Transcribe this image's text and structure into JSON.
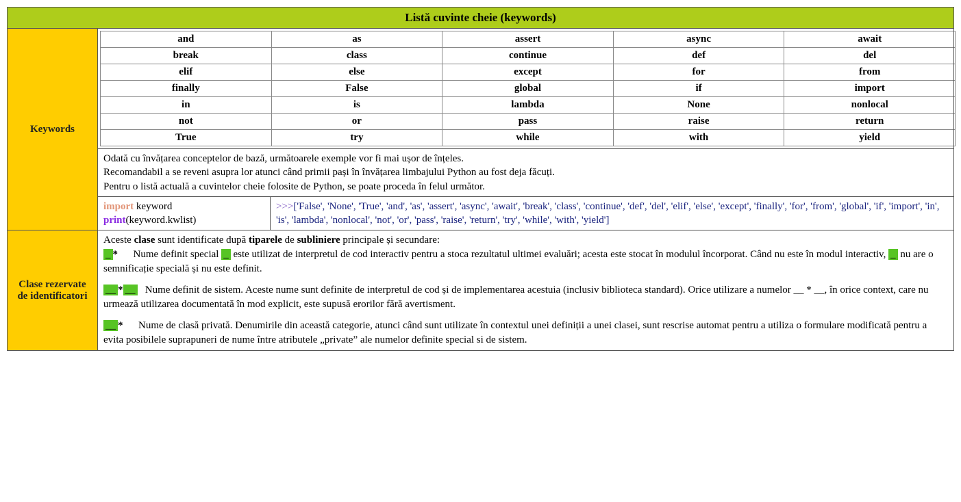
{
  "title": "Listă cuvinte cheie (keywords)",
  "labels": {
    "keywords": "Keywords",
    "reserved": "Clase rezervate de identificatori"
  },
  "keywords_grid": [
    [
      "and",
      "as",
      "assert",
      "async",
      "await"
    ],
    [
      "break",
      "class",
      "continue",
      "def",
      "del"
    ],
    [
      "elif",
      "else",
      "except",
      "for",
      "from"
    ],
    [
      "finally",
      "False",
      "global",
      "if",
      "import"
    ],
    [
      "in",
      "is",
      "lambda",
      "None",
      "nonlocal"
    ],
    [
      "not",
      "or",
      "pass",
      "raise",
      "return"
    ],
    [
      "True",
      "try",
      "while",
      "with",
      "yield"
    ]
  ],
  "description": {
    "line1": "Odată cu învățarea conceptelor de bază, următoarele exemple vor fi mai ușor de înțeles.",
    "line2": "Recomandabil a se reveni asupra lor atunci când primii pași în învățarea limbajului Python au fost deja făcuți.",
    "line3": "Pentru o listă actuală a cuvintelor cheie folosite de Python, se poate proceda în felul următor."
  },
  "code": {
    "import_kw": "import",
    "import_mod": " keyword",
    "print_kw": "print",
    "print_arg": "(keyword.kwlist)"
  },
  "output": {
    "prompt": ">>>",
    "body": "['False', 'None', 'True', 'and', 'as', 'assert', 'async', 'await', 'break', 'class', 'continue', 'def', 'del', 'elif', 'else', 'except', 'finally', 'for', 'from', 'global', 'if', 'import', 'in', 'is', 'lambda', 'nonlocal', 'not', 'or', 'pass', 'raise', 'return', 'try', 'while', 'with', 'yield']"
  },
  "ident": {
    "intro_pre": "Aceste ",
    "intro_b1": "clase",
    "intro_mid1": " sunt identificate după ",
    "intro_b2": "tiparele",
    "intro_mid2": " de ",
    "intro_b3": "subliniere",
    "intro_post": " principale și secundare:",
    "p1_underscore": "_",
    "p1_star": "*",
    "p1_pre": "      Nume definit special ",
    "p1_u2": "_",
    "p1_mid": " este utilizat de interpretul de cod interactiv pentru a stoca rezultatul ultimei evaluări; acesta este stocat în modulul încorporat. Când nu este în modul interactiv, ",
    "p1_u3": "_",
    "p1_post": " nu are o semnificație specială și nu este definit.",
    "p2_underscore": "__",
    "p2_star": "*",
    "p2_underscore2": "__",
    "p2_body": "   Nume definit de sistem. Aceste nume sunt definite de interpretul de cod și de implementarea acestuia (inclusiv biblioteca standard). Orice utilizare a numelor __ * __, în orice context, care nu urmează utilizarea documentată în mod explicit, este supusă erorilor fără avertisment.",
    "p3_underscore": "__",
    "p3_star": "*",
    "p3_body": "      Nume de clasă privată. Denumirile din această categorie, atunci când sunt utilizate în contextul unei definiții a unei clasei, sunt rescrise automat pentru a utiliza o formulare modificată pentru a evita posibilele suprapuneri de nume între atributele „private” ale numelor definite special si de sistem."
  }
}
